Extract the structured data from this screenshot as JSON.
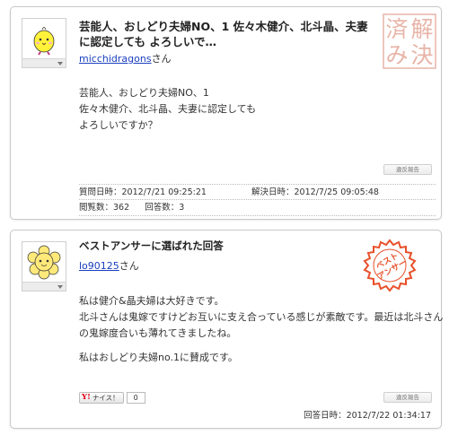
{
  "question": {
    "title": "芸能人、おしどり夫婦NO、1 佐々木健介、北斗晶、夫妻に認定しても よろしいで…",
    "username": "micchidragons",
    "san": "さん",
    "body_lines": [
      "芸能人、おしどり夫婦NO、1",
      "佐々木健介、北斗晶、夫妻に認定しても",
      "よろしいですか？"
    ],
    "report_label": "違反報告",
    "asked_label": "質問日時：",
    "asked_value": "2012/7/21 09:25:21",
    "resolved_label": "解決日時：",
    "resolved_value": "2012/7/25 09:05:48",
    "views_label": "閲覧数：",
    "views_value": "362",
    "answers_label": "回答数：",
    "answers_value": "3",
    "stamp_text": [
      "解",
      "決",
      "済",
      "み"
    ]
  },
  "best_answer": {
    "title": "ベストアンサーに選ばれた回答",
    "username": "lo90125",
    "san": "さん",
    "paragraph1": [
      "私は健介&晶夫婦は大好きです。",
      "北斗さんは鬼嫁ですけどお互いに支え合っている感じが素敵です。最近は北斗さん",
      "の鬼嫁度合いも薄れてきましたね。"
    ],
    "paragraph2": [
      "私はおしどり夫婦no.1に賛成です。"
    ],
    "like_label": "ナイス！",
    "like_y": "Y!",
    "like_count": "0",
    "report_label": "違反報告",
    "answered_label": "回答日時：",
    "answered_value": "2012/7/22 01:34:17",
    "stamp_text_lines": [
      "ベスト",
      "アンサー"
    ]
  },
  "colors": {
    "link": "#1a3fbf",
    "stamp_solved": "#e8b4a8",
    "stamp_best": "#e8502a"
  }
}
